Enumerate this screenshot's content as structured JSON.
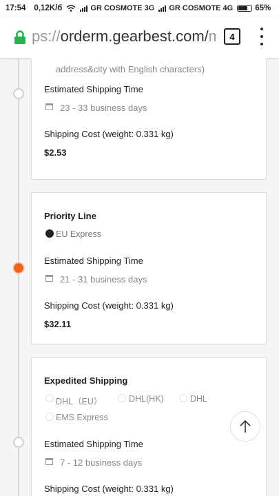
{
  "status_bar": {
    "time": "17:54",
    "speed": "0,12K/б",
    "carrier1": "GR COSMOTE 3G",
    "carrier2": "GR COSMOTE 4G",
    "battery": "65%"
  },
  "browser": {
    "url_dim": "ps://",
    "url_main": "orderm.gearbest.com/",
    "url_tail": "m",
    "tab_count": "4"
  },
  "note": "address&city with English characters)",
  "labels": {
    "eta": "Estimated Shipping Time",
    "cost": "Shipping Cost (weight: 0.331 kg)"
  },
  "methods": [
    {
      "days": "23 - 33 business days",
      "price": "$2.53"
    },
    {
      "title": "Priority Line",
      "option": "EU Express",
      "days": "21 - 31 business days",
      "price": "$32.11"
    },
    {
      "title": "Expedited Shipping",
      "options": [
        "DHL（EU）",
        "DHL(HK)",
        "DHL",
        "EMS Express"
      ],
      "days": "7 - 12 business days"
    }
  ]
}
